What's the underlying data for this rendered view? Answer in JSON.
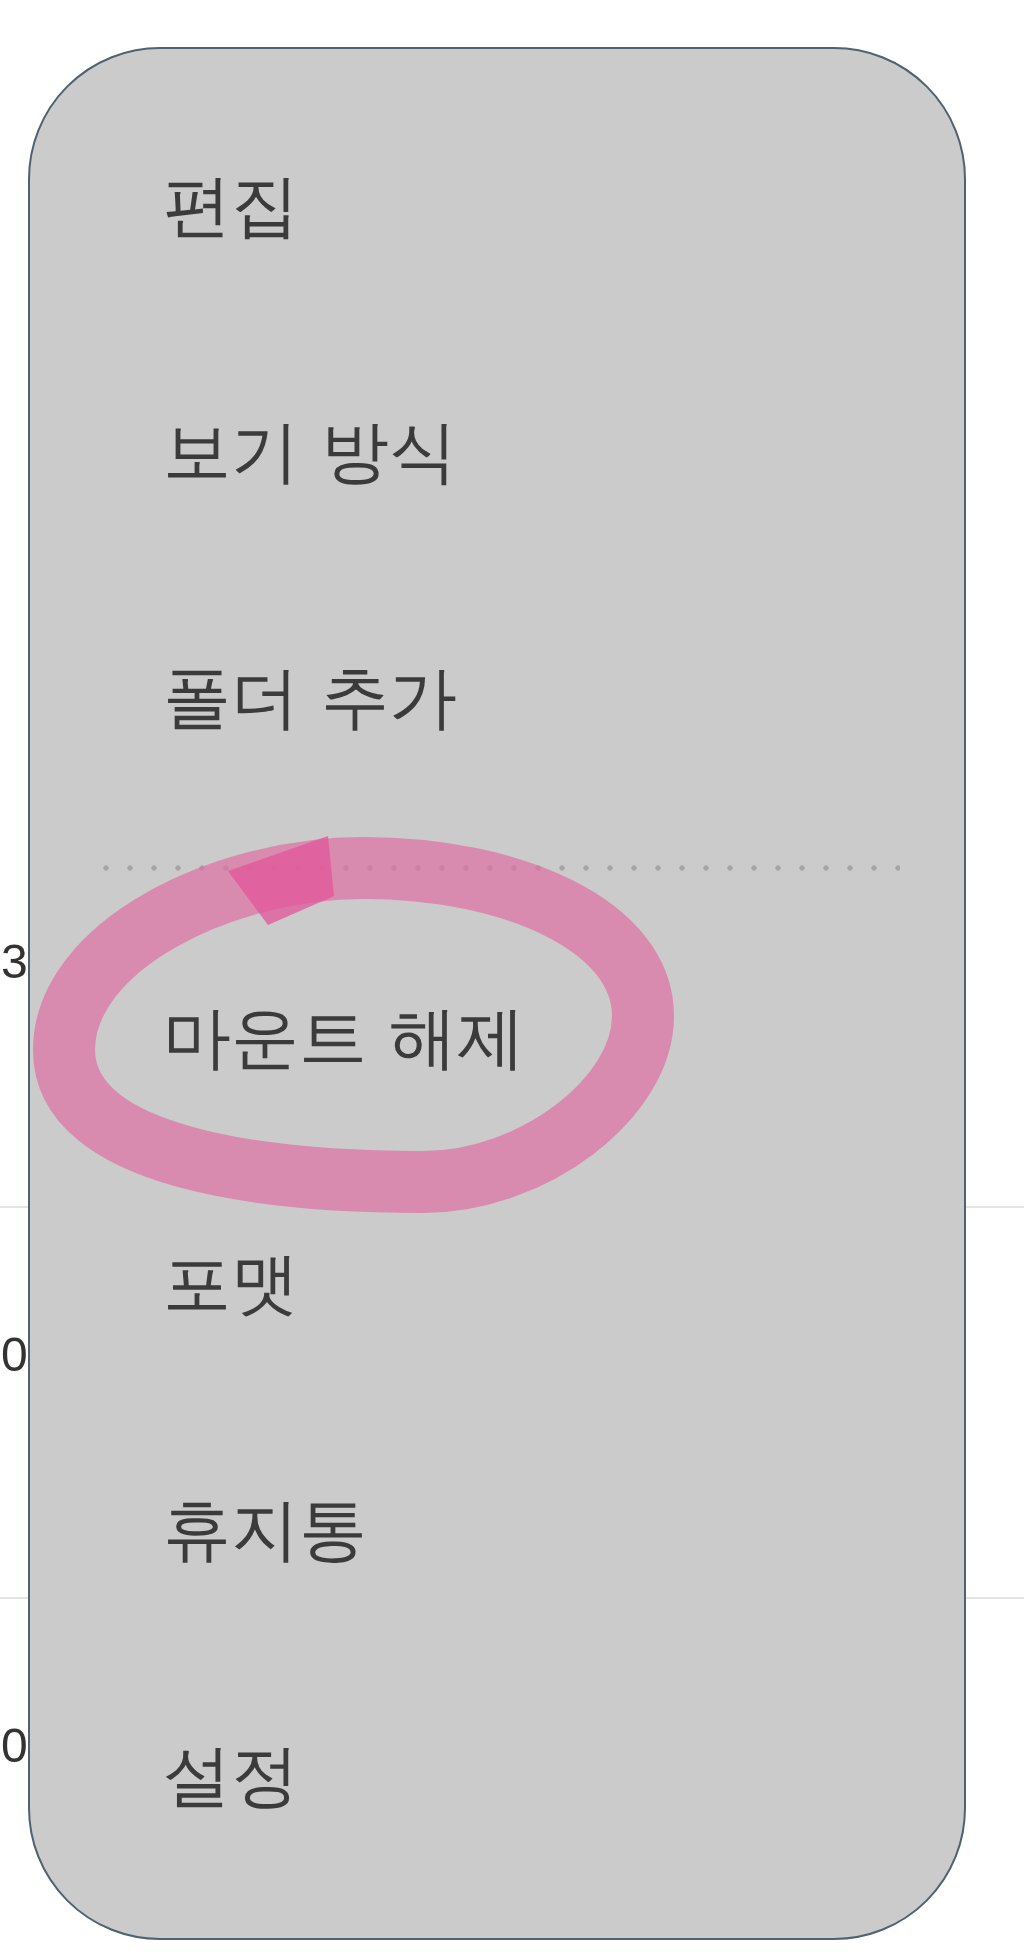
{
  "background": {
    "rows": [
      {
        "text": "3"
      },
      {
        "text": "0"
      },
      {
        "text": "0"
      }
    ]
  },
  "menu": {
    "sections": [
      {
        "items": [
          {
            "label": "편집",
            "circled": false
          },
          {
            "label": "보기 방식",
            "circled": false
          },
          {
            "label": "폴더 추가",
            "circled": false
          }
        ]
      },
      {
        "items": [
          {
            "label": "마운트 해제",
            "circled": true
          },
          {
            "label": "포맷",
            "circled": false
          },
          {
            "label": "휴지통",
            "circled": false
          },
          {
            "label": "설정",
            "circled": false
          }
        ]
      }
    ]
  }
}
